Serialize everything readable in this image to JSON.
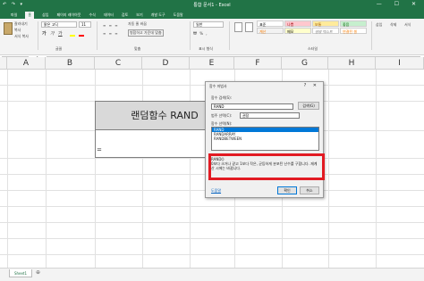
{
  "titlebar": {
    "title": "통합 문서1 - Excel",
    "quick_access": "↶ ↷ ▾",
    "controls": "— ☐ ✕"
  },
  "menu": [
    "파일",
    "홈",
    "삽입",
    "페이지 레이아웃",
    "수식",
    "데이터",
    "검토",
    "보기",
    "개발 도구",
    "도움말"
  ],
  "ribbon": {
    "clipboard": {
      "cut": "잘라내기",
      "copy": "복사",
      "paste_format": "서식 복사"
    },
    "font": {
      "name": "맑은 고딕",
      "size": "11",
      "group_label": "글꼴"
    },
    "align": {
      "wrap": "자동 줄 바꿈",
      "merge": "병합하고 가운데 맞춤",
      "group_label": "맞춤"
    },
    "number": {
      "format": "일반",
      "group_label": "표시 형식"
    },
    "styles": {
      "items": [
        "표준",
        "나쁨",
        "보통",
        "좋음",
        "계산",
        "메모",
        "설명 텍스트",
        "연결된 셀"
      ],
      "group_label": "스타일"
    },
    "cells": {
      "insert": "삽입",
      "delete": "삭제",
      "format": "서식"
    }
  },
  "formula_bar": {
    "name_box": "",
    "fx": "fx",
    "content": "="
  },
  "columns": [
    "A",
    "B",
    "C",
    "D",
    "E",
    "F",
    "G",
    "H",
    "I"
  ],
  "cell_c3": "랜덤함수 RAND",
  "cell_c4": "=",
  "dialog": {
    "title": "함수 마법사",
    "controls": "? ✕",
    "search_label": "함수 검색(S):",
    "search_value": "RAND",
    "go_button": "검색(G)",
    "category_label": "범주 선택(C):",
    "category_value": "권장",
    "select_label": "함수 선택(N):",
    "functions": [
      "RAND",
      "RANDARRAY",
      "RANDBETWEEN"
    ],
    "syntax": "RAND()",
    "description": "0보다 크거나 같고 1보다 작은, 균등하게 분포된 난수를 구합니다. 재계산 시에는 바뀝니다.",
    "help_link": "도움말",
    "ok_button": "확인",
    "cancel_button": "취소"
  },
  "sheet_tab": "Sheet1"
}
